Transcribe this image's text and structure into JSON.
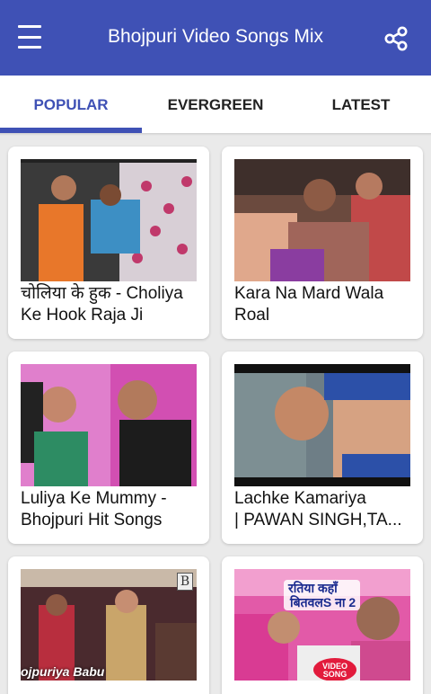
{
  "app": {
    "title": "Bhojpuri Video Songs Mix",
    "menu_icon": "hamburger-menu-icon",
    "share_icon": "share-icon",
    "brand_color": "#3f51b5"
  },
  "tabs": [
    {
      "label": "POPULAR",
      "active": true
    },
    {
      "label": "EVERGREEN",
      "active": false
    },
    {
      "label": "LATEST",
      "active": false
    }
  ],
  "videos": [
    {
      "title": "चोलिया के हुक - Choliya Ke Hook Raja Ji"
    },
    {
      "title": "Kara Na Mard Wala Roal"
    },
    {
      "title": "Luliya Ke Mummy - Bhojpuri Hit Songs"
    },
    {
      "title_line1": "Lachke Kamariya",
      "title_line2": "| PAWAN SINGH,TA..."
    },
    {
      "overlay_text": "ojpuriya Babu",
      "badge": "B"
    },
    {
      "poster_line1": "रतिया कहाँ",
      "poster_line2": "बितवलS ना 2",
      "poster_badge_line1": "VIDEO",
      "poster_badge_line2": "SONG"
    }
  ]
}
